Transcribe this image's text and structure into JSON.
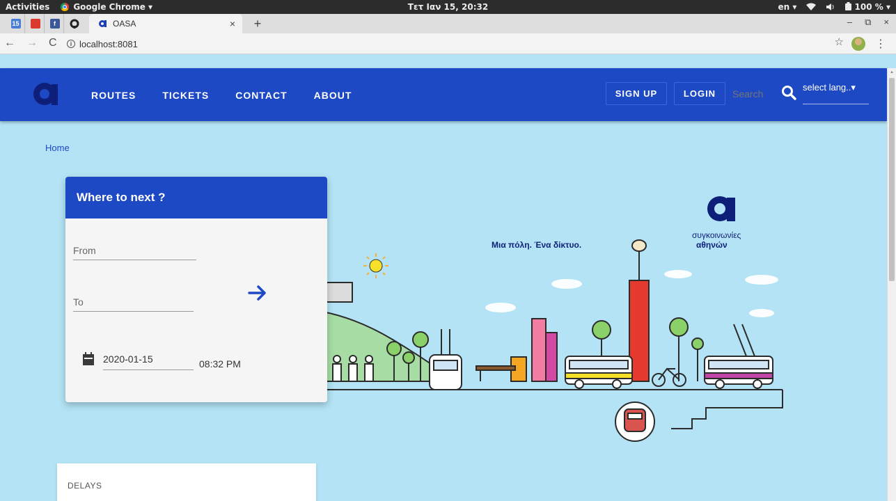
{
  "system_bar": {
    "activities": "Activities",
    "app_name": "Google Chrome ▾",
    "clock": "Τετ Ιαν 15, 20:32",
    "lang": "en ▾",
    "battery": "100 % ▾"
  },
  "browser": {
    "pinned_tabs": [
      {
        "icon": "calendar-icon",
        "text": "15"
      },
      {
        "icon": "todoist-icon",
        "text": ""
      },
      {
        "icon": "facebook-icon",
        "text": "f"
      },
      {
        "icon": "github-icon",
        "text": ""
      }
    ],
    "active_tab_title": "OASA",
    "tab_close": "×",
    "new_tab": "+",
    "window_controls": [
      "–",
      "⧉",
      "×"
    ],
    "nav": {
      "back": "←",
      "forward": "→",
      "reload": "C"
    },
    "url": "localhost:8081",
    "bookmark_star": "☆",
    "menu": "⋮"
  },
  "navbar": {
    "menu": [
      "ROUTES",
      "TICKETS",
      "CONTACT",
      "ABOUT"
    ],
    "signup": "SIGN UP",
    "login": "LOGIN",
    "search_placeholder": "Search",
    "lang_select": "select lang..▾",
    "brand_color": "#1d49c4"
  },
  "breadcrumb": {
    "home": "Home"
  },
  "trip_card": {
    "title": "Where to next ?",
    "from_label": "From",
    "to_label": "To",
    "date": "2020-01-15",
    "time": "08:32 PM"
  },
  "hero": {
    "slogan": "Μια πόλη. Ένα δίκτυο.",
    "brand_line1": "συγκοινωνίες",
    "brand_line2": "αθηνών"
  },
  "delays": {
    "label": "DELAYS"
  }
}
